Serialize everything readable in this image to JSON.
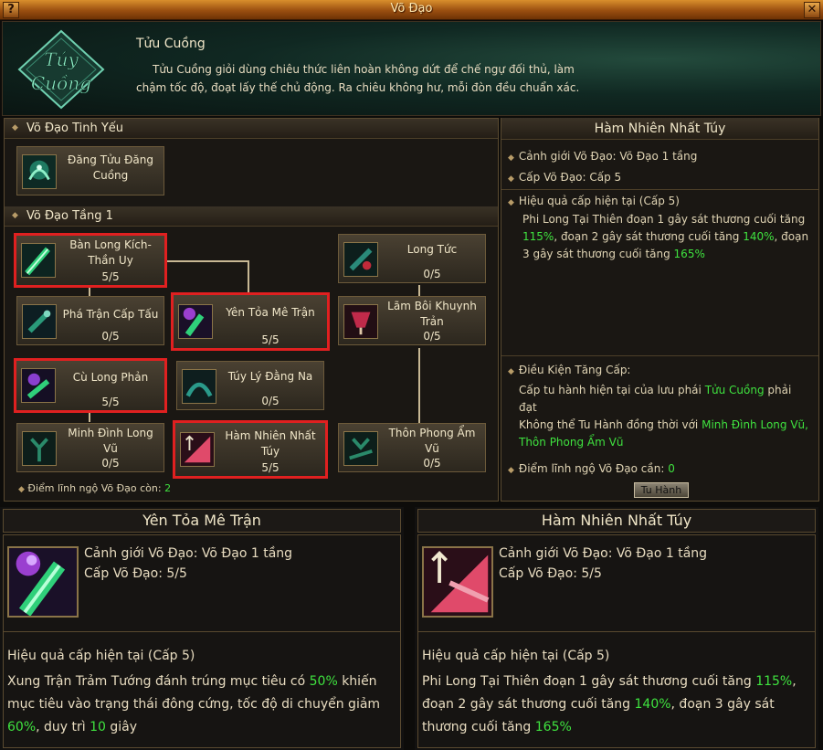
{
  "window": {
    "title": "Võ Đạo",
    "help_label": "?",
    "close_label": "✕"
  },
  "header": {
    "emblem_text": "Túy Cuồng",
    "name": "Tửu Cuồng",
    "description": "Tửu Cuồng giỏi dùng chiêu thức liên hoàn không dứt để chế ngự đối thủ, làm chậm tốc độ, đoạt lấy thế chủ động. Ra chiêu không hư, mỗi đòn đều chuẩn xác."
  },
  "tree": {
    "section_core": "Võ Đạo Tinh Yếu",
    "core_skill": {
      "name": "Đăng Tửu Đăng Cuồng",
      "icon": "wine-dragon-icon"
    },
    "section_tier1": "Võ Đạo Tầng 1",
    "skills": [
      {
        "id": "ban-long",
        "name": "Bàn Long Kích-Thần Uy",
        "level": "5/5",
        "selected": true,
        "color": "#2fd07a"
      },
      {
        "id": "pha-tran",
        "name": "Phá Trận Cấp Tấu",
        "level": "0/5",
        "selected": false,
        "color": "#2a9a7a"
      },
      {
        "id": "yen-toa",
        "name": "Yên Tỏa Mê Trận",
        "level": "5/5",
        "selected": true,
        "color": "#9a3fd0"
      },
      {
        "id": "cu-long",
        "name": "Cù Long Phản",
        "level": "5/5",
        "selected": true,
        "color": "#8a3fd0"
      },
      {
        "id": "tuy-ly",
        "name": "Túy Lý Đằng Na",
        "level": "0/5",
        "selected": false,
        "color": "#2a9a8a"
      },
      {
        "id": "minh-dinh",
        "name": "Minh Đình Long Vũ",
        "level": "0/5",
        "selected": false,
        "color": "#2a8a6a"
      },
      {
        "id": "ham-nhien",
        "name": "Hàm Nhiên Nhất Túy",
        "level": "5/5",
        "selected": true,
        "color": "#e04a6a"
      },
      {
        "id": "long-tuc",
        "name": "Long Tức",
        "level": "0/5",
        "selected": false,
        "color": "#2a8a7a"
      },
      {
        "id": "lam-boi",
        "name": "Lãm Bôi Khuynh Trản",
        "level": "0/5",
        "selected": false,
        "color": "#c02a4a"
      },
      {
        "id": "thon-phong",
        "name": "Thôn Phong Ẩm Vũ",
        "level": "0/5",
        "selected": false,
        "color": "#2a8a6a"
      }
    ],
    "points_label": "Điểm lĩnh ngộ Võ Đạo còn:",
    "points_value": "2"
  },
  "info": {
    "title": "Hàm Nhiên Nhất Túy",
    "realm": "Cảnh giới Võ Đạo: Võ Đạo 1 tầng",
    "level": "Cấp Võ Đạo: Cấp 5",
    "effect_header": "Hiệu quả cấp hiện tại (Cấp 5)",
    "effect_parts": [
      "Phi Long Tại Thiên đoạn 1 gây sát thương cuối tăng ",
      "115%",
      ", đoạn 2 gây sát thương cuối tăng ",
      "140%",
      ", đoạn 3 gây sát thương cuối tăng ",
      "165%"
    ],
    "condition_header": "Điều Kiện Tăng Cấp:",
    "cond_text1": "Cấp tu hành hiện tại của lưu phái ",
    "cond_school": "Tửu Cuồng",
    "cond_text2": " phải đạt",
    "cond_text3": "Không thể Tu Hành đồng thời với ",
    "cond_skill1": "Minh Đình Long Vũ,",
    "cond_skill2": "Thôn Phong Ẩm Vũ",
    "points_label": "Điểm lĩnh ngộ Võ Đạo cần:",
    "points_value": "0",
    "train_button": "Tu Hành"
  },
  "tooltip_left": {
    "title": "Yên Tỏa Mê Trận",
    "icon": "smoke-staff-icon",
    "realm": "Cảnh giới Võ Đạo: Võ Đạo 1 tầng",
    "level": "Cấp Võ Đạo: 5/5",
    "effect_header": "Hiệu quả cấp hiện tại (Cấp 5)",
    "effect_parts": [
      "Xung Trận Trảm Tướng đánh trúng mục tiêu có ",
      "50%",
      " khiến mục tiêu vào trạng thái đông cứng, tốc độ di chuyển giảm ",
      "60%",
      ", duy trì ",
      "10",
      " giây"
    ]
  },
  "tooltip_right": {
    "title": "Hàm Nhiên Nhất Túy",
    "icon": "trident-fan-icon",
    "realm": "Cảnh giới Võ Đạo: Võ Đạo 1 tầng",
    "level": "Cấp Võ Đạo: 5/5",
    "effect_header": "Hiệu quả cấp hiện tại (Cấp 5)",
    "effect_parts": [
      "Phi Long Tại Thiên đoạn 1 gây sát thương cuối tăng ",
      "115%",
      ", đoạn 2 gây sát thương cuối tăng ",
      "140%",
      ", đoạn 3 gây sát thương cuối tăng ",
      "165%"
    ]
  }
}
